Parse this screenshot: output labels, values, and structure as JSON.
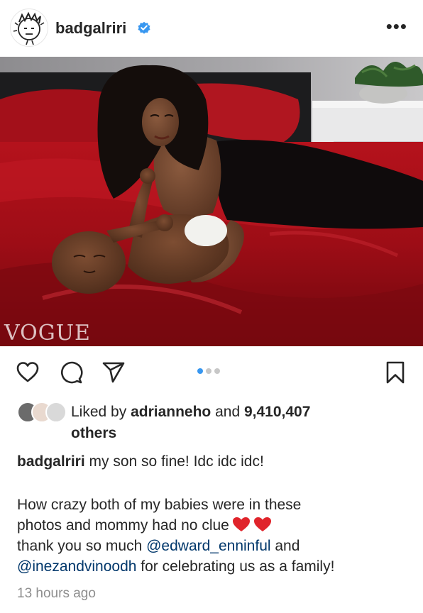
{
  "header": {
    "username": "badgalriri",
    "more_label": "•••"
  },
  "photo": {
    "watermark": "VOGUE"
  },
  "carousel": {
    "count": 3,
    "active_index": 0
  },
  "likes": {
    "prefix": "Liked by ",
    "liker": "adrianneho",
    "middle": " and ",
    "count": "9,410,407",
    "suffix": "others"
  },
  "caption": {
    "username": "badgalriri",
    "line1": " my son so fine! Idc idc idc!",
    "para2_line1": "How crazy both of my babies were in these",
    "para2_line2": "photos and mommy had no clue",
    "para2_line3_prefix": "thank you so much ",
    "mention1": "@edward_enninful",
    "para2_line3_suffix": " and",
    "mention2": "@inezandvinoodh",
    "para2_line4_suffix": " for celebrating us as a family!"
  },
  "timestamp": "13 hours ago",
  "colors": {
    "verified": "#3897f0",
    "mention": "#00376b",
    "heart": "#e0242b",
    "muted": "#8e8e8e"
  },
  "icons": [
    "avatar-sketch-icon",
    "verified-badge-icon",
    "more-options-icon",
    "heart-icon",
    "comment-icon",
    "share-icon",
    "bookmark-icon",
    "red-heart-emoji-icon"
  ]
}
